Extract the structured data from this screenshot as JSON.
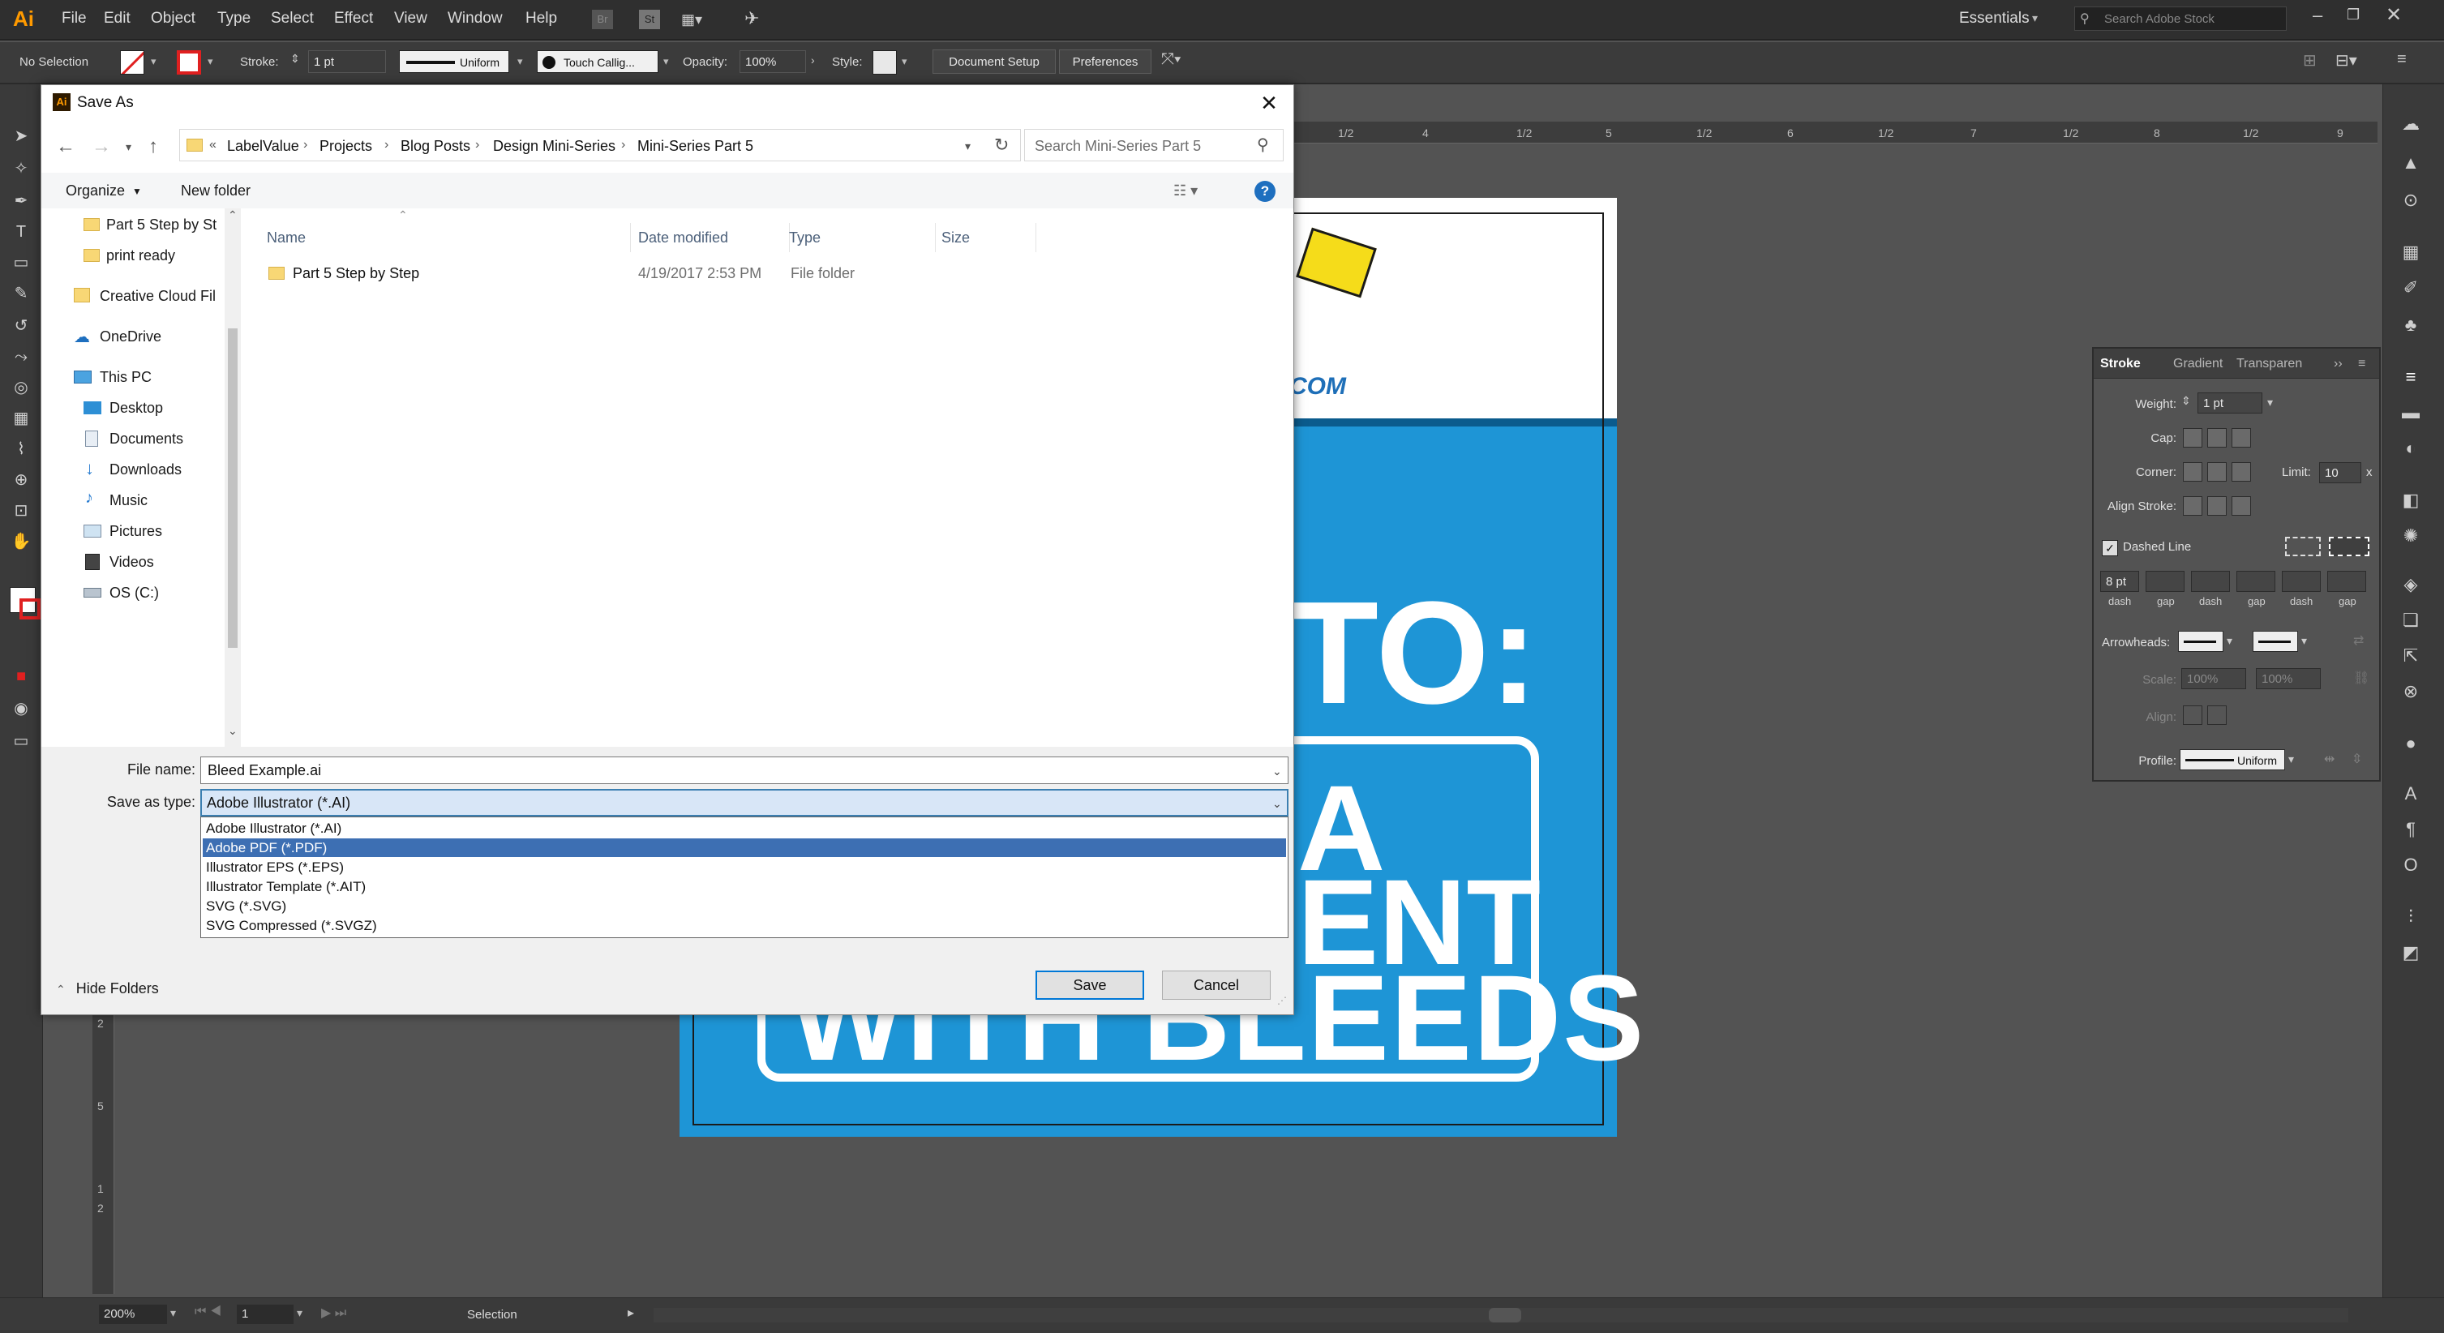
{
  "app": {
    "logo": "Ai",
    "menu": [
      "File",
      "Edit",
      "Object",
      "Type",
      "Select",
      "Effect",
      "View",
      "Window",
      "Help"
    ],
    "workspace": "Essentials",
    "stock_search_placeholder": "Search Adobe Stock"
  },
  "control_bar": {
    "selection": "No Selection",
    "stroke_label": "Stroke:",
    "stroke_value": "1 pt",
    "profile": "Uniform",
    "brush": "Touch Callig...",
    "opacity_label": "Opacity:",
    "opacity_value": "100%",
    "style_label": "Style:",
    "document_setup": "Document Setup",
    "preferences": "Preferences"
  },
  "rulers": {
    "top": [
      "1/2",
      "4",
      "1/2",
      "5",
      "1/2",
      "6",
      "1/2",
      "7",
      "1/2",
      "8",
      "1/2",
      "9"
    ],
    "left": [
      "2",
      "5",
      "1",
      "2"
    ]
  },
  "artwork": {
    "logo_text": "COM",
    "line1": "TO:",
    "line2": "A",
    "line3": "ENT",
    "line4": "WITH BLEEDS"
  },
  "stroke_panel": {
    "tabs": [
      "Stroke",
      "Gradient",
      "Transparen"
    ],
    "weight_label": "Weight:",
    "weight_value": "1 pt",
    "cap_label": "Cap:",
    "corner_label": "Corner:",
    "limit_label": "Limit:",
    "limit_value": "10",
    "limit_unit": "x",
    "align_label": "Align Stroke:",
    "dashed_label": "Dashed Line",
    "dashed_checked": true,
    "dash_first_value": "8 pt",
    "dash_labels": [
      "dash",
      "gap",
      "dash",
      "gap",
      "dash",
      "gap"
    ],
    "arrowheads_label": "Arrowheads:",
    "scale_label": "Scale:",
    "scale_values": [
      "100%",
      "100%"
    ],
    "align_arrow_label": "Align:",
    "profile_label": "Profile:",
    "profile_value": "Uniform"
  },
  "status": {
    "zoom": "200%",
    "artboard": "1",
    "tool": "Selection"
  },
  "dialog": {
    "title": "Save As",
    "breadcrumbs": [
      "LabelValue",
      "Projects",
      "Blog Posts",
      "Design Mini-Series",
      "Mini-Series Part 5"
    ],
    "breadcrumb_prefix": "«",
    "search_placeholder": "Search Mini-Series Part 5",
    "organize": "Organize",
    "new_folder": "New folder",
    "nav": [
      {
        "label": "Part 5 Step by St",
        "icon": "folder-icon"
      },
      {
        "label": "print ready",
        "icon": "folder-icon"
      },
      {
        "label": "Creative Cloud Fil",
        "icon": "creative-cloud-icon"
      },
      {
        "label": "OneDrive",
        "icon": "onedrive-icon"
      },
      {
        "label": "This PC",
        "icon": "pc-icon"
      },
      {
        "label": "Desktop",
        "icon": "desktop-icon"
      },
      {
        "label": "Documents",
        "icon": "documents-icon"
      },
      {
        "label": "Downloads",
        "icon": "downloads-icon"
      },
      {
        "label": "Music",
        "icon": "music-icon"
      },
      {
        "label": "Pictures",
        "icon": "pictures-icon"
      },
      {
        "label": "Videos",
        "icon": "videos-icon"
      },
      {
        "label": "OS (C:)",
        "icon": "drive-icon"
      }
    ],
    "columns": [
      "Name",
      "Date modified",
      "Type",
      "Size"
    ],
    "files": [
      {
        "name": "Part 5 Step by Step",
        "date": "4/19/2017 2:53 PM",
        "type": "File folder",
        "size": ""
      }
    ],
    "file_name_label": "File name:",
    "file_name_value": "Bleed Example.ai",
    "save_type_label": "Save as type:",
    "save_type_value": "Adobe Illustrator (*.AI)",
    "save_type_options": [
      "Adobe Illustrator (*.AI)",
      "Adobe PDF (*.PDF)",
      "Illustrator EPS (*.EPS)",
      "Illustrator Template (*.AIT)",
      "SVG (*.SVG)",
      "SVG Compressed (*.SVGZ)"
    ],
    "highlighted_option": "Adobe PDF (*.PDF)",
    "save_button": "Save",
    "cancel_button": "Cancel",
    "hide_folders": "Hide Folders"
  },
  "colors": {
    "app_bg": "#535353",
    "artwork_blue": "#1e95d6",
    "selection_blue": "#3d6fb3",
    "ai_orange": "#ff9a00"
  }
}
